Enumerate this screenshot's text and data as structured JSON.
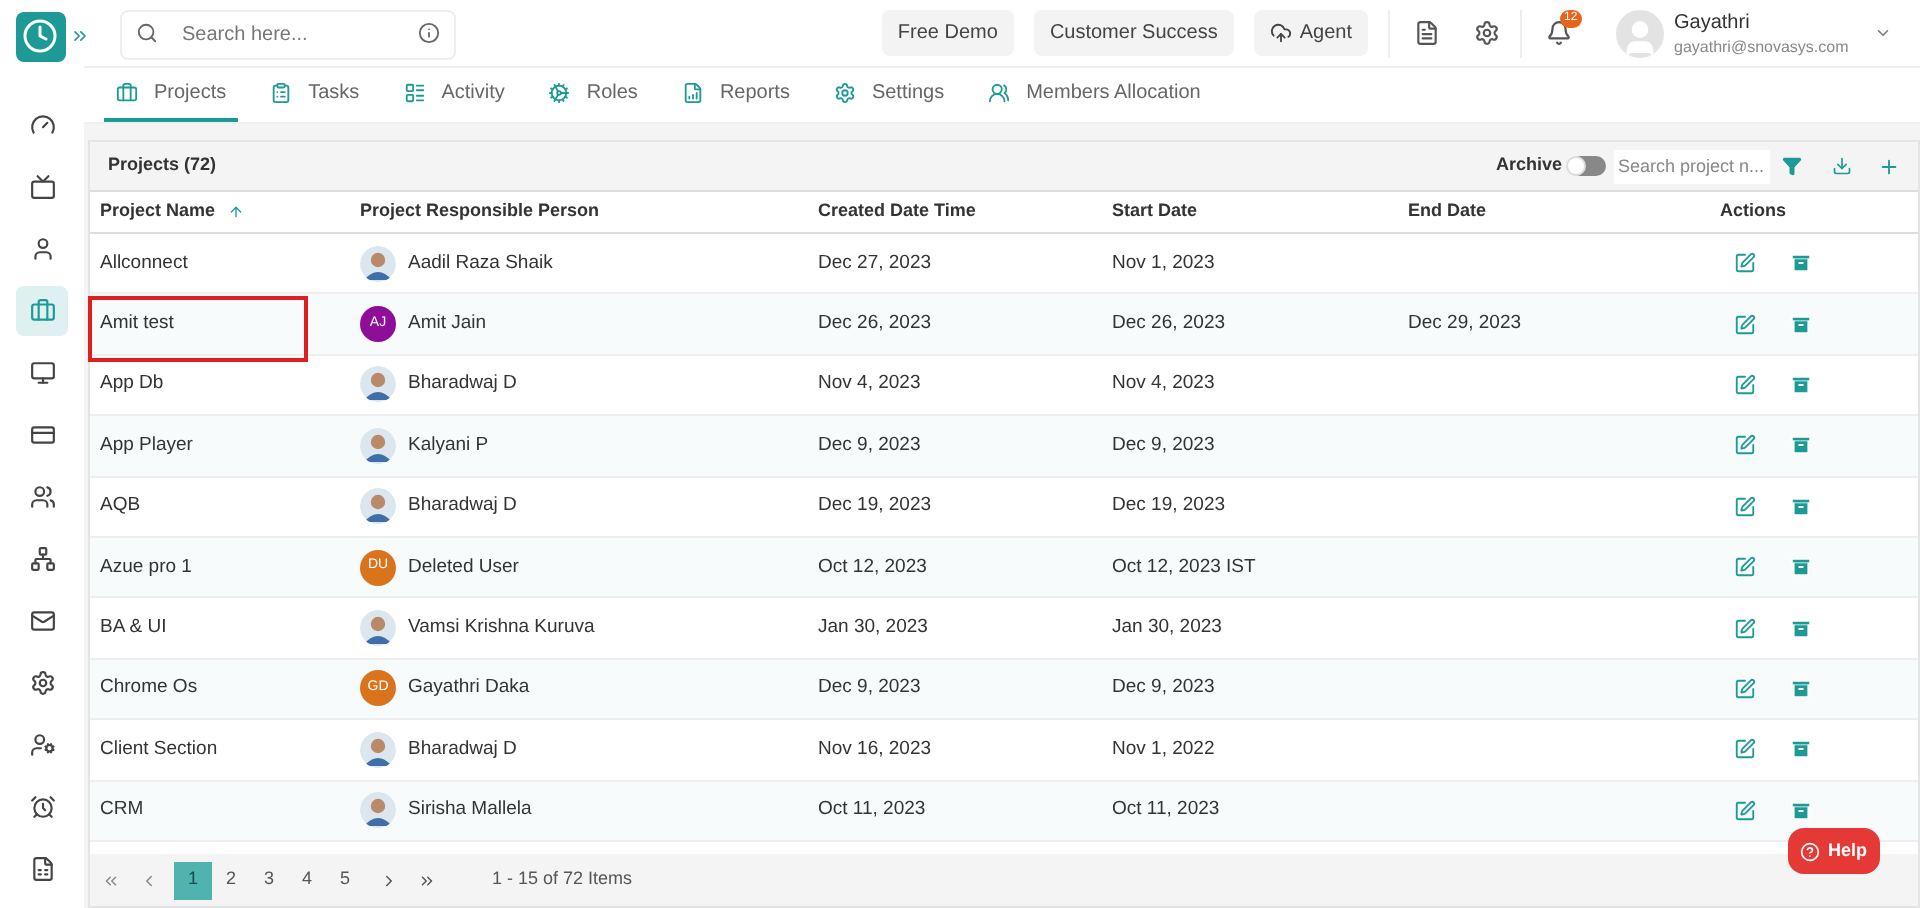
{
  "search": {
    "placeholder": "Search here..."
  },
  "header_buttons": [
    {
      "label": "Free Demo",
      "kind": "plain"
    },
    {
      "label": "Customer Success",
      "kind": "plain"
    },
    {
      "label": "Agent",
      "kind": "cloud"
    }
  ],
  "notifications": {
    "count": "12"
  },
  "user": {
    "name": "Gayathri",
    "email": "gayathri@snovasys.com"
  },
  "sidebar": {
    "items": [
      {
        "kind": "gauge",
        "selected": false
      },
      {
        "kind": "tv",
        "selected": false
      },
      {
        "kind": "user",
        "selected": false
      },
      {
        "kind": "briefcase",
        "selected": true
      },
      {
        "kind": "monitor",
        "selected": false
      },
      {
        "kind": "card",
        "selected": false
      },
      {
        "kind": "users",
        "selected": false
      },
      {
        "kind": "team",
        "selected": false
      },
      {
        "kind": "mail",
        "selected": false
      },
      {
        "kind": "gear",
        "selected": false
      },
      {
        "kind": "admin",
        "selected": false
      },
      {
        "kind": "alarm",
        "selected": false
      },
      {
        "kind": "invoice",
        "selected": false
      }
    ]
  },
  "tabs": [
    {
      "label": "Projects",
      "kind": "briefcase",
      "selected": true
    },
    {
      "label": "Tasks",
      "kind": "clipboard",
      "selected": false
    },
    {
      "label": "Activity",
      "kind": "activity",
      "selected": false
    },
    {
      "label": "Roles",
      "kind": "roles",
      "selected": false
    },
    {
      "label": "Reports",
      "kind": "reports",
      "selected": false
    },
    {
      "label": "Settings",
      "kind": "settings",
      "selected": false
    },
    {
      "label": "Members Allocation",
      "kind": "members",
      "selected": false
    }
  ],
  "table": {
    "title": "Projects (72)",
    "archive": {
      "label": "Archive",
      "on": false
    },
    "search": {
      "placeholder": "Search project n..."
    },
    "columns": [
      "Project Name",
      "Project Responsible Person",
      "Created Date Time",
      "Start Date",
      "End Date",
      "Actions"
    ],
    "rows": [
      {
        "name": "Allconnect",
        "person": "Aadil Raza Shaik",
        "avatar": {
          "kind": "photo"
        },
        "created": "Dec 27, 2023",
        "start": "Nov 1, 2023",
        "highlighted": false
      },
      {
        "name": "Amit test",
        "person": "Amit Jain",
        "avatar": {
          "kind": "initials",
          "text": "AJ",
          "color": "#8e0e9a"
        },
        "created": "Dec 26, 2023",
        "start": "Dec 26, 2023",
        "end": "Dec 29, 2023",
        "highlighted": true
      },
      {
        "name": "App Db",
        "person": "Bharadwaj D",
        "avatar": {
          "kind": "photo"
        },
        "created": "Nov 4, 2023",
        "start": "Nov 4, 2023",
        "highlighted": false
      },
      {
        "name": "App Player",
        "person": "Kalyani P",
        "avatar": {
          "kind": "photo"
        },
        "created": "Dec 9, 2023",
        "start": "Dec 9, 2023",
        "highlighted": false
      },
      {
        "name": "AQB",
        "person": "Bharadwaj D",
        "avatar": {
          "kind": "photo"
        },
        "created": "Dec 19, 2023",
        "start": "Dec 19, 2023",
        "highlighted": false
      },
      {
        "name": "Azue pro 1",
        "person": "Deleted User",
        "avatar": {
          "kind": "initials",
          "text": "DU",
          "color": "#d9731c"
        },
        "created": "Oct 12, 2023",
        "start": "Oct 12, 2023 IST",
        "highlighted": false
      },
      {
        "name": "BA & UI",
        "person": "Vamsi Krishna Kuruva",
        "avatar": {
          "kind": "photo"
        },
        "created": "Jan 30, 2023",
        "start": "Jan 30, 2023",
        "highlighted": false
      },
      {
        "name": "Chrome Os",
        "person": "Gayathri Daka",
        "avatar": {
          "kind": "initials",
          "text": "GD",
          "color": "#d9731c"
        },
        "created": "Dec 9, 2023",
        "start": "Dec 9, 2023",
        "highlighted": false
      },
      {
        "name": "Client Section",
        "person": "Bharadwaj D",
        "avatar": {
          "kind": "photo"
        },
        "created": "Nov 16, 2023",
        "start": "Nov 1, 2022",
        "highlighted": false
      },
      {
        "name": "CRM",
        "person": "Sirisha Mallela",
        "avatar": {
          "kind": "photo"
        },
        "created": "Oct 11, 2023",
        "start": "Oct 11, 2023",
        "highlighted": false
      }
    ]
  },
  "pagination": {
    "pages": [
      {
        "label": "1",
        "selected": true
      },
      {
        "label": "2",
        "selected": false
      },
      {
        "label": "3",
        "selected": false
      },
      {
        "label": "4",
        "selected": false
      },
      {
        "label": "5",
        "selected": false
      }
    ],
    "summary": "1 - 15 of 72 Items"
  },
  "help": {
    "label": "Help"
  }
}
